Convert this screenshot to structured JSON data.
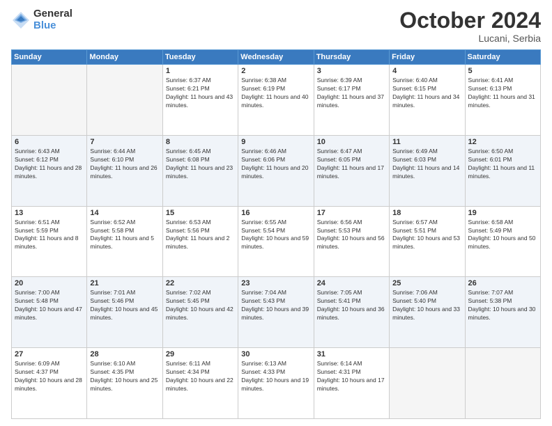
{
  "logo": {
    "general": "General",
    "blue": "Blue"
  },
  "header": {
    "month": "October 2024",
    "location": "Lucani, Serbia"
  },
  "weekdays": [
    "Sunday",
    "Monday",
    "Tuesday",
    "Wednesday",
    "Thursday",
    "Friday",
    "Saturday"
  ],
  "weeks": [
    [
      {
        "day": "",
        "empty": true
      },
      {
        "day": "",
        "empty": true
      },
      {
        "day": "1",
        "sunrise": "Sunrise: 6:37 AM",
        "sunset": "Sunset: 6:21 PM",
        "daylight": "Daylight: 11 hours and 43 minutes."
      },
      {
        "day": "2",
        "sunrise": "Sunrise: 6:38 AM",
        "sunset": "Sunset: 6:19 PM",
        "daylight": "Daylight: 11 hours and 40 minutes."
      },
      {
        "day": "3",
        "sunrise": "Sunrise: 6:39 AM",
        "sunset": "Sunset: 6:17 PM",
        "daylight": "Daylight: 11 hours and 37 minutes."
      },
      {
        "day": "4",
        "sunrise": "Sunrise: 6:40 AM",
        "sunset": "Sunset: 6:15 PM",
        "daylight": "Daylight: 11 hours and 34 minutes."
      },
      {
        "day": "5",
        "sunrise": "Sunrise: 6:41 AM",
        "sunset": "Sunset: 6:13 PM",
        "daylight": "Daylight: 11 hours and 31 minutes."
      }
    ],
    [
      {
        "day": "6",
        "sunrise": "Sunrise: 6:43 AM",
        "sunset": "Sunset: 6:12 PM",
        "daylight": "Daylight: 11 hours and 28 minutes."
      },
      {
        "day": "7",
        "sunrise": "Sunrise: 6:44 AM",
        "sunset": "Sunset: 6:10 PM",
        "daylight": "Daylight: 11 hours and 26 minutes."
      },
      {
        "day": "8",
        "sunrise": "Sunrise: 6:45 AM",
        "sunset": "Sunset: 6:08 PM",
        "daylight": "Daylight: 11 hours and 23 minutes."
      },
      {
        "day": "9",
        "sunrise": "Sunrise: 6:46 AM",
        "sunset": "Sunset: 6:06 PM",
        "daylight": "Daylight: 11 hours and 20 minutes."
      },
      {
        "day": "10",
        "sunrise": "Sunrise: 6:47 AM",
        "sunset": "Sunset: 6:05 PM",
        "daylight": "Daylight: 11 hours and 17 minutes."
      },
      {
        "day": "11",
        "sunrise": "Sunrise: 6:49 AM",
        "sunset": "Sunset: 6:03 PM",
        "daylight": "Daylight: 11 hours and 14 minutes."
      },
      {
        "day": "12",
        "sunrise": "Sunrise: 6:50 AM",
        "sunset": "Sunset: 6:01 PM",
        "daylight": "Daylight: 11 hours and 11 minutes."
      }
    ],
    [
      {
        "day": "13",
        "sunrise": "Sunrise: 6:51 AM",
        "sunset": "Sunset: 5:59 PM",
        "daylight": "Daylight: 11 hours and 8 minutes."
      },
      {
        "day": "14",
        "sunrise": "Sunrise: 6:52 AM",
        "sunset": "Sunset: 5:58 PM",
        "daylight": "Daylight: 11 hours and 5 minutes."
      },
      {
        "day": "15",
        "sunrise": "Sunrise: 6:53 AM",
        "sunset": "Sunset: 5:56 PM",
        "daylight": "Daylight: 11 hours and 2 minutes."
      },
      {
        "day": "16",
        "sunrise": "Sunrise: 6:55 AM",
        "sunset": "Sunset: 5:54 PM",
        "daylight": "Daylight: 10 hours and 59 minutes."
      },
      {
        "day": "17",
        "sunrise": "Sunrise: 6:56 AM",
        "sunset": "Sunset: 5:53 PM",
        "daylight": "Daylight: 10 hours and 56 minutes."
      },
      {
        "day": "18",
        "sunrise": "Sunrise: 6:57 AM",
        "sunset": "Sunset: 5:51 PM",
        "daylight": "Daylight: 10 hours and 53 minutes."
      },
      {
        "day": "19",
        "sunrise": "Sunrise: 6:58 AM",
        "sunset": "Sunset: 5:49 PM",
        "daylight": "Daylight: 10 hours and 50 minutes."
      }
    ],
    [
      {
        "day": "20",
        "sunrise": "Sunrise: 7:00 AM",
        "sunset": "Sunset: 5:48 PM",
        "daylight": "Daylight: 10 hours and 47 minutes."
      },
      {
        "day": "21",
        "sunrise": "Sunrise: 7:01 AM",
        "sunset": "Sunset: 5:46 PM",
        "daylight": "Daylight: 10 hours and 45 minutes."
      },
      {
        "day": "22",
        "sunrise": "Sunrise: 7:02 AM",
        "sunset": "Sunset: 5:45 PM",
        "daylight": "Daylight: 10 hours and 42 minutes."
      },
      {
        "day": "23",
        "sunrise": "Sunrise: 7:04 AM",
        "sunset": "Sunset: 5:43 PM",
        "daylight": "Daylight: 10 hours and 39 minutes."
      },
      {
        "day": "24",
        "sunrise": "Sunrise: 7:05 AM",
        "sunset": "Sunset: 5:41 PM",
        "daylight": "Daylight: 10 hours and 36 minutes."
      },
      {
        "day": "25",
        "sunrise": "Sunrise: 7:06 AM",
        "sunset": "Sunset: 5:40 PM",
        "daylight": "Daylight: 10 hours and 33 minutes."
      },
      {
        "day": "26",
        "sunrise": "Sunrise: 7:07 AM",
        "sunset": "Sunset: 5:38 PM",
        "daylight": "Daylight: 10 hours and 30 minutes."
      }
    ],
    [
      {
        "day": "27",
        "sunrise": "Sunrise: 6:09 AM",
        "sunset": "Sunset: 4:37 PM",
        "daylight": "Daylight: 10 hours and 28 minutes."
      },
      {
        "day": "28",
        "sunrise": "Sunrise: 6:10 AM",
        "sunset": "Sunset: 4:35 PM",
        "daylight": "Daylight: 10 hours and 25 minutes."
      },
      {
        "day": "29",
        "sunrise": "Sunrise: 6:11 AM",
        "sunset": "Sunset: 4:34 PM",
        "daylight": "Daylight: 10 hours and 22 minutes."
      },
      {
        "day": "30",
        "sunrise": "Sunrise: 6:13 AM",
        "sunset": "Sunset: 4:33 PM",
        "daylight": "Daylight: 10 hours and 19 minutes."
      },
      {
        "day": "31",
        "sunrise": "Sunrise: 6:14 AM",
        "sunset": "Sunset: 4:31 PM",
        "daylight": "Daylight: 10 hours and 17 minutes."
      },
      {
        "day": "",
        "empty": true
      },
      {
        "day": "",
        "empty": true
      }
    ]
  ]
}
